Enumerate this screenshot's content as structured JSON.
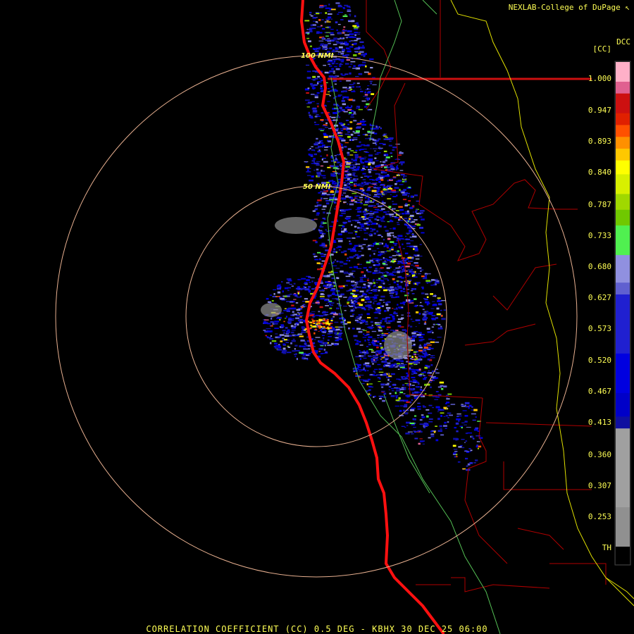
{
  "header": {
    "credit": "NEXLAB-College of DuPage",
    "credit_icon": "cursor-arrow-icon"
  },
  "product": {
    "code": "DCC",
    "unit": "[CC]"
  },
  "color_scale": {
    "labels": [
      "1.000",
      "0.947",
      "0.893",
      "0.840",
      "0.787",
      "0.733",
      "0.680",
      "0.627",
      "0.573",
      "0.520",
      "0.467",
      "0.413",
      "0.360",
      "0.307",
      "0.253",
      "TH"
    ],
    "colors": [
      "#ffb0c8",
      "#e06090",
      "#cc1010",
      "#e02000",
      "#ff5000",
      "#ff9000",
      "#ffc800",
      "#ffff00",
      "#d8f000",
      "#a0d800",
      "#70c800",
      "#50f050",
      "#9090e0",
      "#6060d0",
      "#2020d0",
      "#0000e0",
      "#0000c8",
      "#1010a0",
      "#a0a0a0",
      "#909090",
      "#000000"
    ]
  },
  "range_rings": [
    {
      "label": "50 NMI"
    },
    {
      "label": "100 NMI"
    }
  ],
  "footer": {
    "caption": "CORRELATION COEFFICIENT (CC) 0.5 DEG - KBHX 30 DEC 25 06:00"
  },
  "colors": {
    "background": "#000000",
    "text": "#ffff55",
    "range_ring": "#e8b090",
    "coastline": "#ff1010",
    "county_border": "#b00000",
    "state_border": "#e0e000",
    "river": "#60d060"
  }
}
